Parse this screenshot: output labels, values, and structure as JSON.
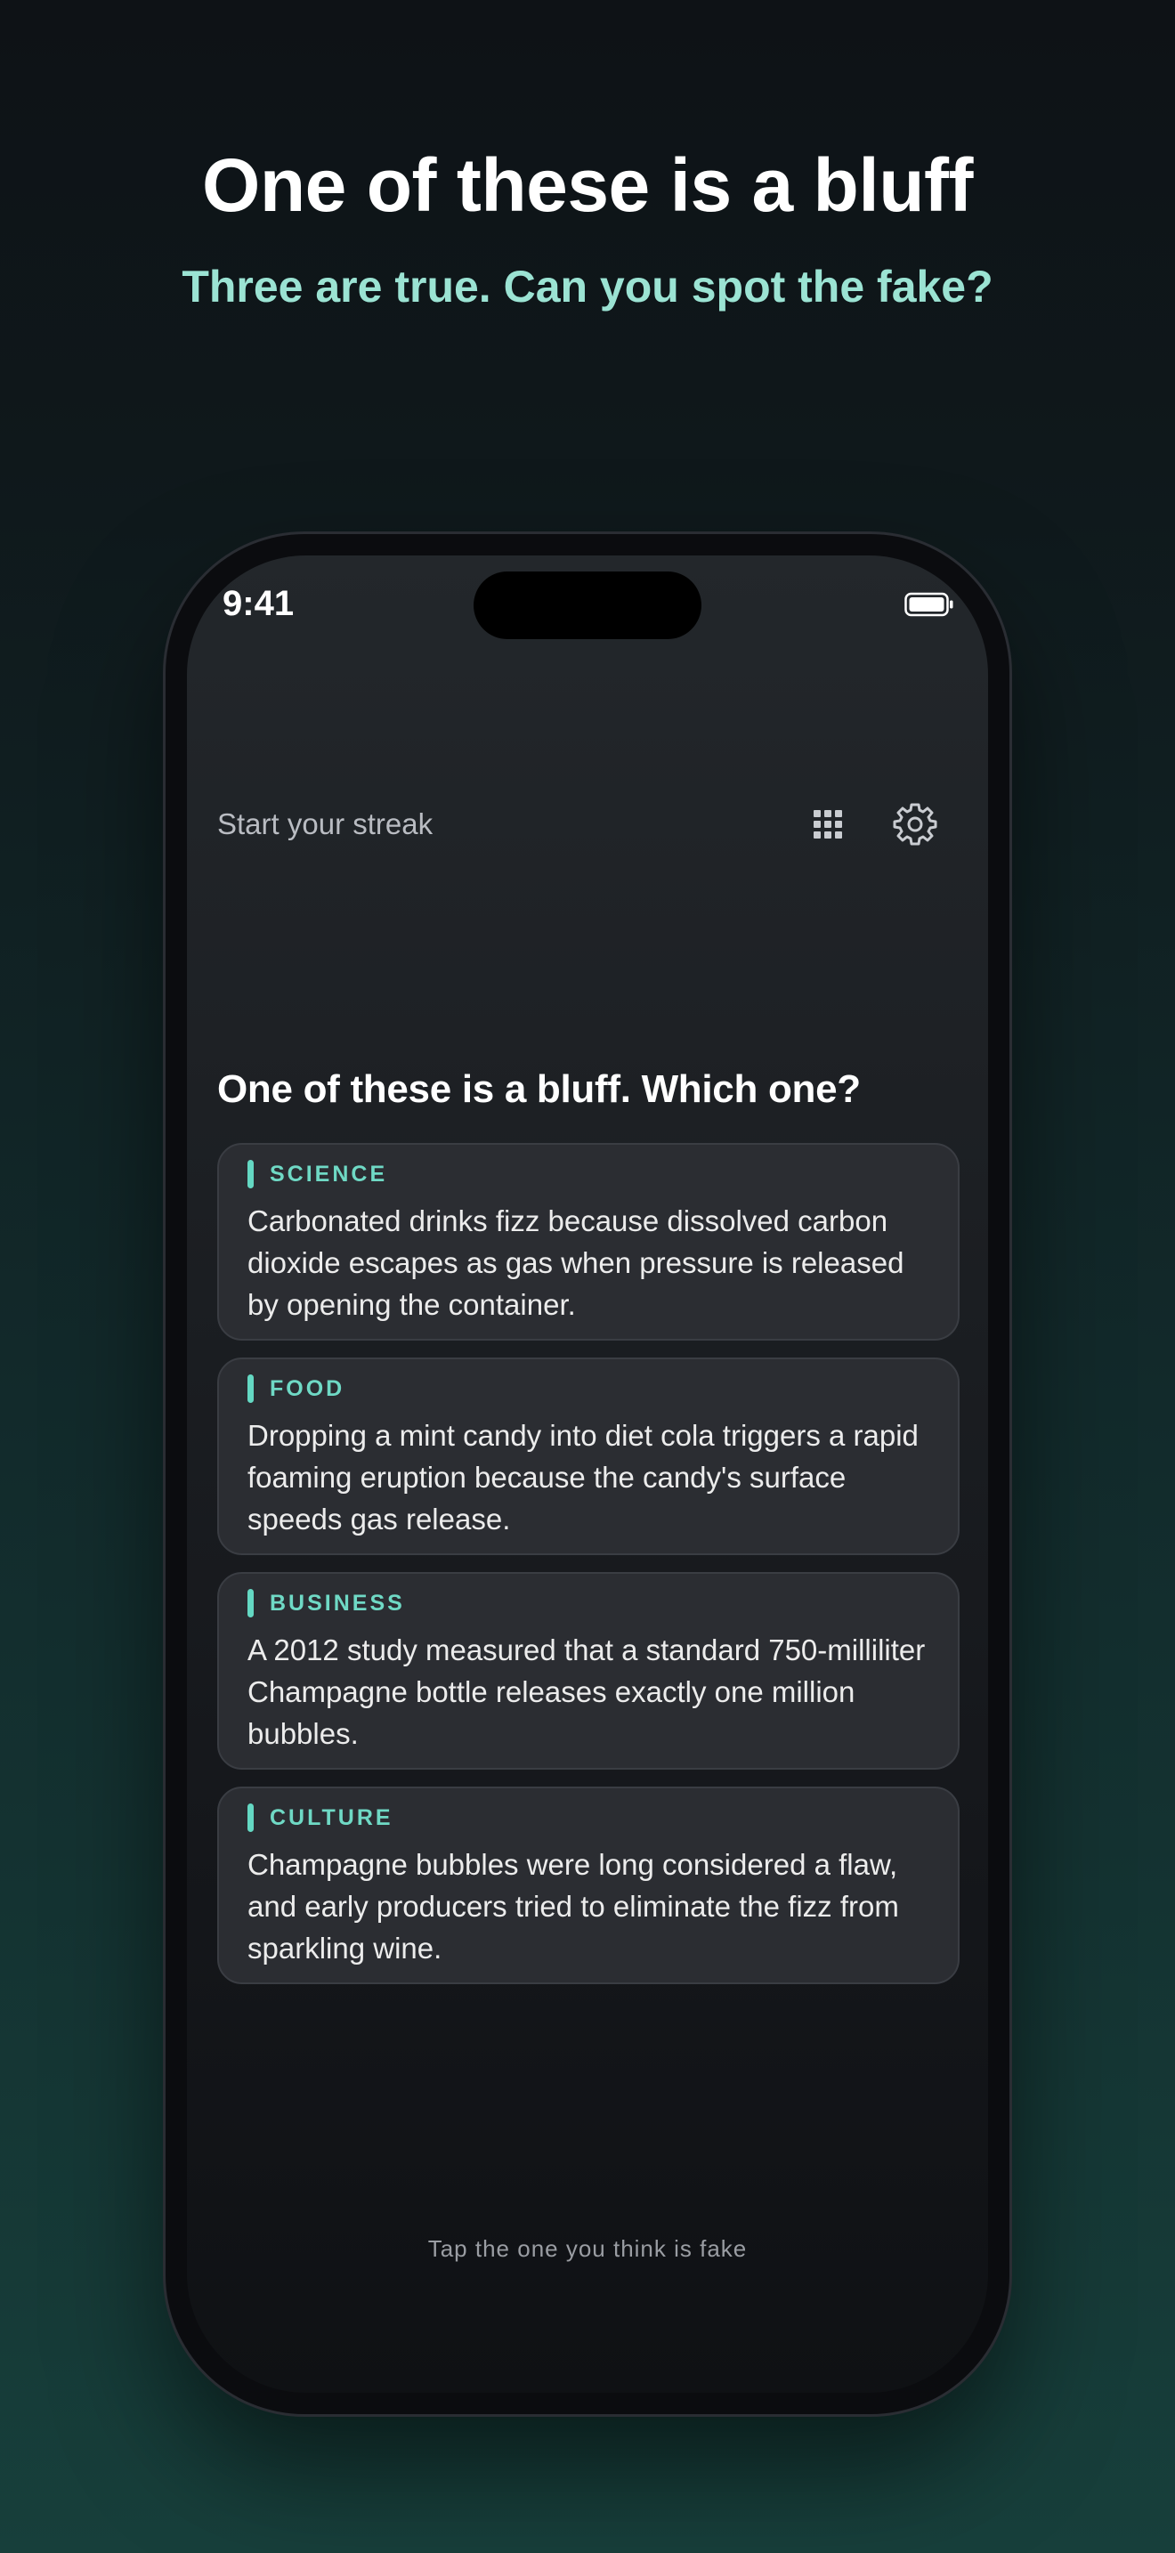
{
  "marketing": {
    "title": "One of these is a bluff",
    "subtitle": "Three are true. Can you spot the fake?"
  },
  "status_bar": {
    "time": "9:41",
    "battery_icon": "battery-full-icon"
  },
  "header": {
    "streak_text": "Start your streak",
    "grid_icon": "grid-icon",
    "settings_icon": "gear-icon"
  },
  "question": "One of these is a bluff. Which one?",
  "cards": [
    {
      "category": "SCIENCE",
      "text": "Carbonated drinks fizz because dissolved carbon dioxide escapes as gas when pressure is released by opening the container."
    },
    {
      "category": "FOOD",
      "text": "Dropping a mint candy into diet cola triggers a rapid foaming eruption because the candy's surface speeds gas release."
    },
    {
      "category": "BUSINESS",
      "text": "A 2012 study measured that a standard 750-milliliter Champagne bottle releases exactly one million bubbles."
    },
    {
      "category": "CULTURE",
      "text": "Champagne bubbles were long considered a flaw, and early producers tried to eliminate the fizz from sparkling wine."
    }
  ],
  "hint": "Tap the one you think is fake",
  "colors": {
    "accent": "#64d8c3",
    "subtitle": "#9be3d3",
    "card_bg": "#2b2d32"
  }
}
